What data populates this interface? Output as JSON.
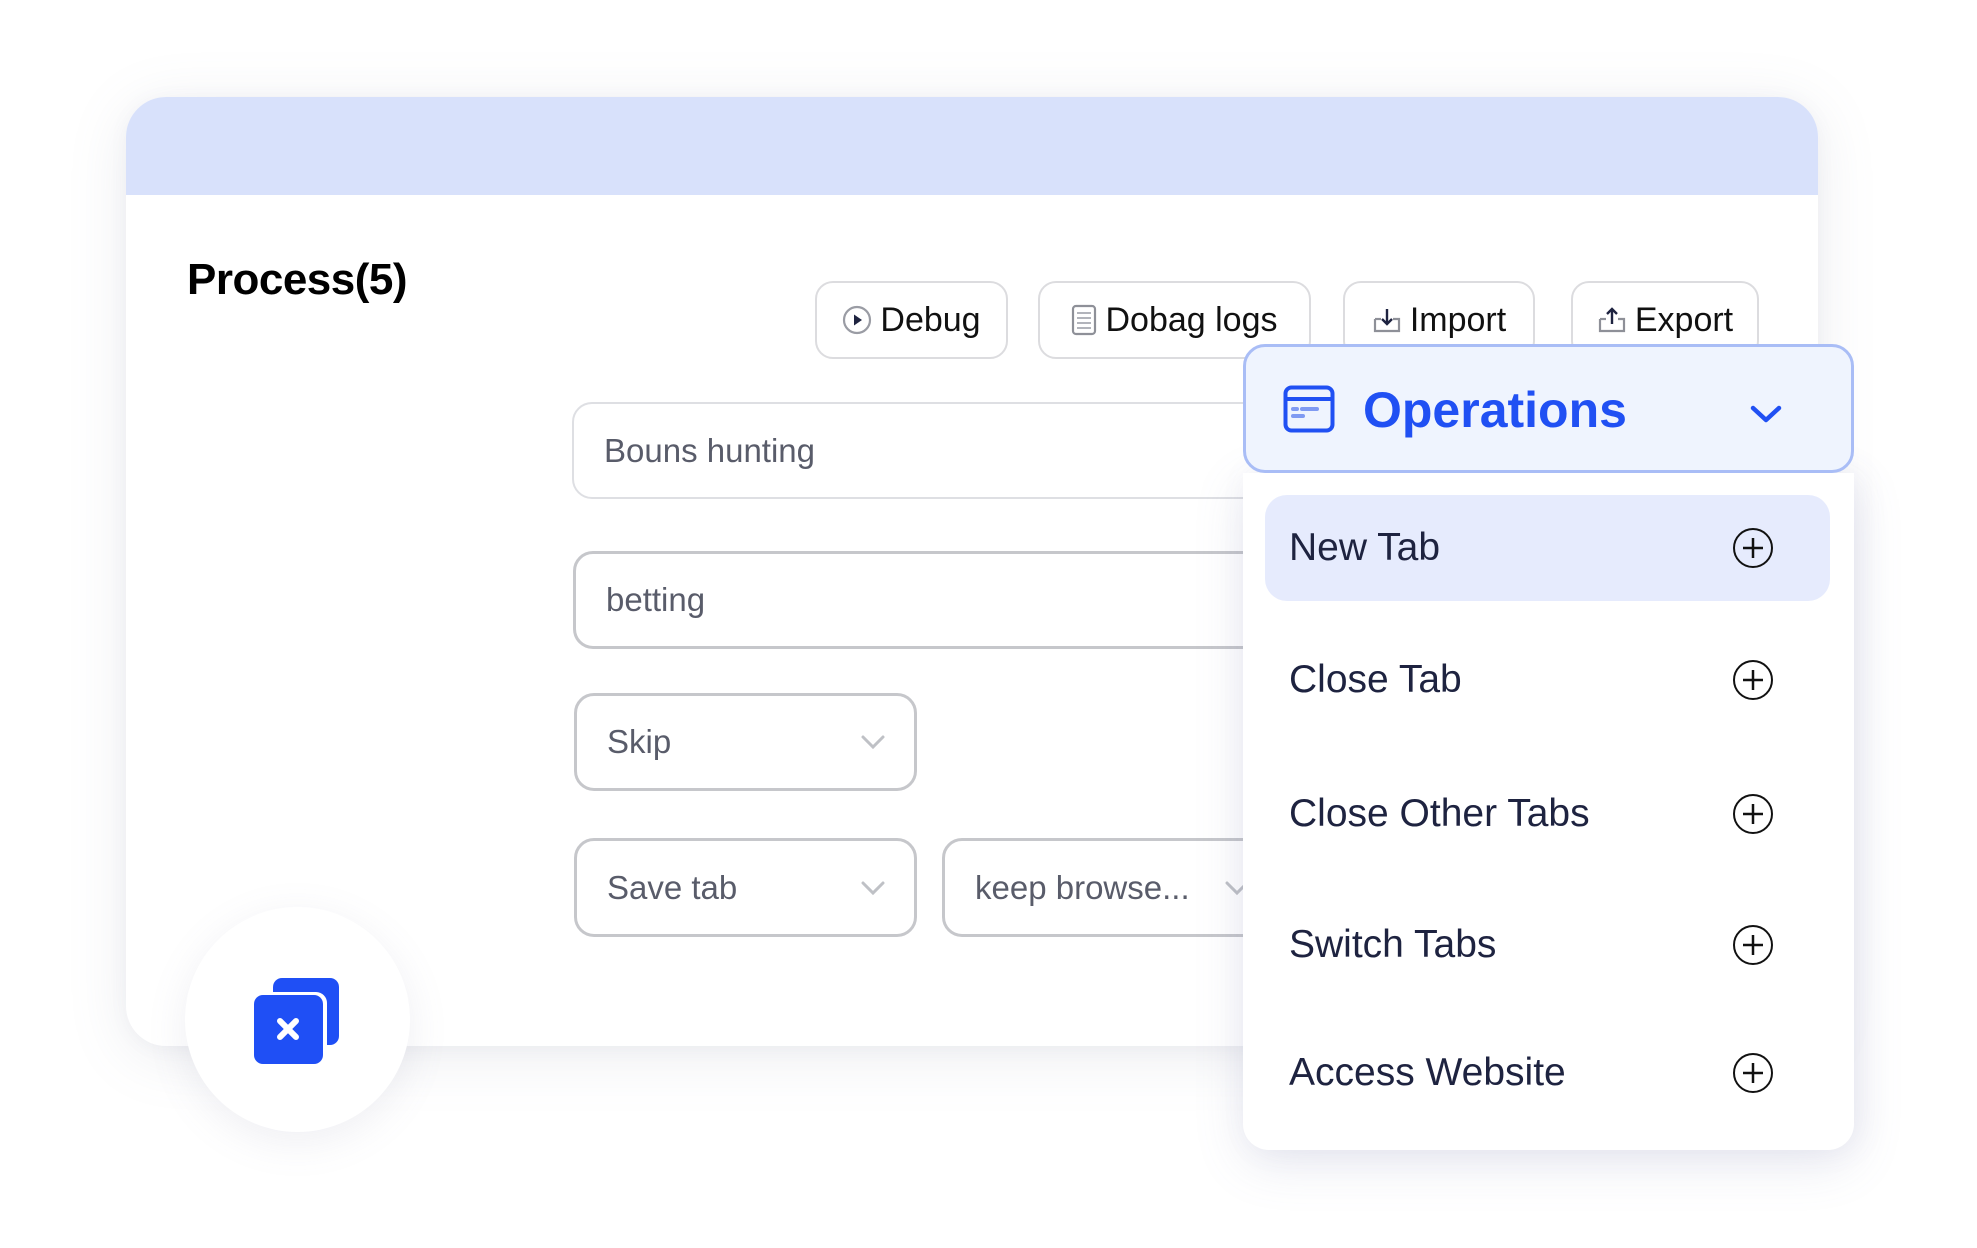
{
  "card": {
    "title": "Process(5)"
  },
  "toolbar": {
    "buttons": [
      {
        "label": "Debug",
        "icon": "play-circle-icon"
      },
      {
        "label": "Dobag logs",
        "icon": "log-list-icon"
      },
      {
        "label": "Import",
        "icon": "import-icon"
      },
      {
        "label": "Export",
        "icon": "export-icon"
      }
    ]
  },
  "form": {
    "name_field": "Bouns hunting",
    "keyword_field": "betting",
    "mode_select": "Skip",
    "tab_select": "Save tab",
    "browser_select": "keep browse..."
  },
  "operations": {
    "label": "Operations",
    "icon": "card-icon",
    "items": [
      {
        "label": "New Tab",
        "active": true
      },
      {
        "label": "Close Tab",
        "active": false
      },
      {
        "label": "Close Other Tabs",
        "active": false
      },
      {
        "label": "Switch Tabs",
        "active": false
      },
      {
        "label": "Access Website",
        "active": false
      }
    ]
  },
  "fab": {
    "icon": "close-tabs-icon"
  },
  "colors": {
    "accent": "#2050f3",
    "header": "#d8e1fb",
    "active_item": "#e6ebfd"
  }
}
